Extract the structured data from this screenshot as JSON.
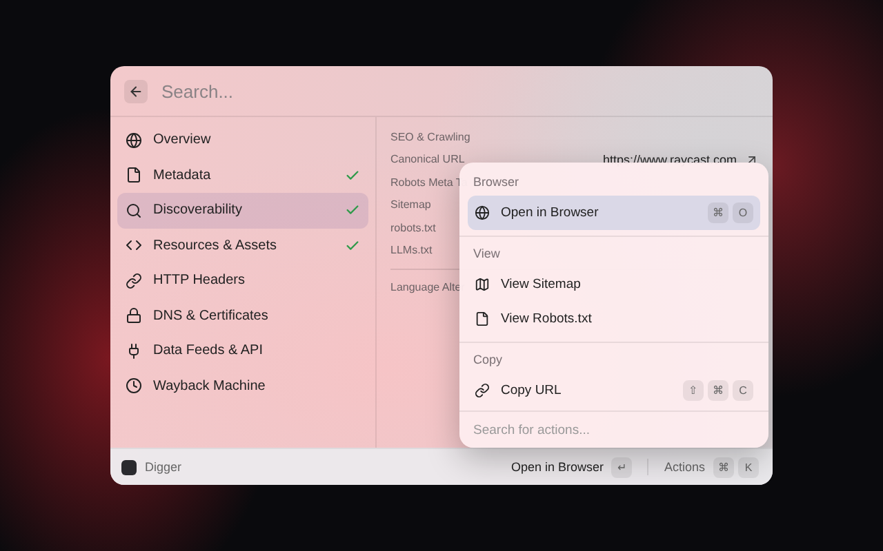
{
  "search": {
    "placeholder": "Search..."
  },
  "sidebar": {
    "items": [
      {
        "label": "Overview",
        "selected": false,
        "checked": false
      },
      {
        "label": "Metadata",
        "selected": false,
        "checked": true
      },
      {
        "label": "Discoverability",
        "selected": true,
        "checked": true
      },
      {
        "label": "Resources & Assets",
        "selected": false,
        "checked": true
      },
      {
        "label": "HTTP Headers",
        "selected": false,
        "checked": false
      },
      {
        "label": "DNS & Certificates",
        "selected": false,
        "checked": false
      },
      {
        "label": "Data Feeds & API",
        "selected": false,
        "checked": false
      },
      {
        "label": "Wayback Machine",
        "selected": false,
        "checked": false
      }
    ]
  },
  "detail": {
    "groups": [
      {
        "rows": [
          {
            "label": "SEO & Crawling"
          },
          {
            "label": "Canonical URL",
            "value": "https://www.raycast.com"
          },
          {
            "label": "Robots Meta Ta"
          },
          {
            "label": "Sitemap"
          },
          {
            "label": "robots.txt"
          },
          {
            "label": "LLMs.txt"
          }
        ]
      },
      {
        "rows": [
          {
            "label": "Language Alter"
          }
        ]
      }
    ]
  },
  "actions": {
    "sections": [
      {
        "title": "Browser",
        "items": [
          {
            "label": "Open in Browser",
            "selected": true,
            "keys": [
              "⌘",
              "O"
            ]
          }
        ]
      },
      {
        "title": "View",
        "items": [
          {
            "label": "View Sitemap",
            "selected": false
          },
          {
            "label": "View Robots.txt",
            "selected": false
          }
        ]
      },
      {
        "title": "Copy",
        "items": [
          {
            "label": "Copy URL",
            "selected": false,
            "keys": [
              "⇧",
              "⌘",
              "C"
            ]
          }
        ]
      }
    ],
    "search": {
      "placeholder": "Search for actions..."
    }
  },
  "footer": {
    "app": "Digger",
    "primary": {
      "label": "Open in Browser",
      "keys": [
        "↵"
      ]
    },
    "secondary": {
      "label": "Actions",
      "keys": [
        "⌘",
        "K"
      ]
    }
  }
}
